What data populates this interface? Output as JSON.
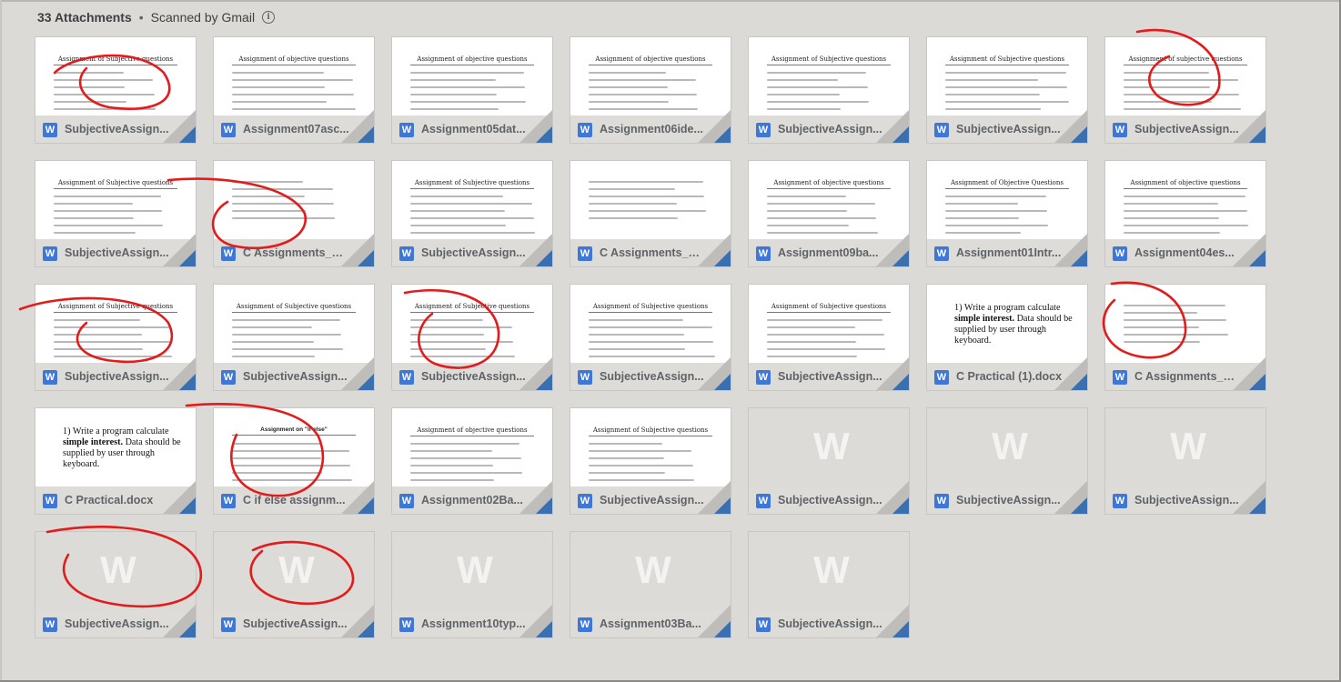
{
  "header": {
    "title": "33 Attachments",
    "separator": "•",
    "scan_status": "Scanned by Gmail",
    "info_icon": "info-icon"
  },
  "attachments": [
    {
      "name": "SubjectiveAssign...",
      "preview_title": "Assignment of Subjective questions",
      "preview": "doc"
    },
    {
      "name": "Assignment07asc...",
      "preview_title": "Assignment of objective questions",
      "preview": "doc"
    },
    {
      "name": "Assignment05dat...",
      "preview_title": "Assignment of objective questions",
      "preview": "doc"
    },
    {
      "name": "Assignment06ide...",
      "preview_title": "Assignment of objective questions",
      "preview": "doc"
    },
    {
      "name": "SubjectiveAssign...",
      "preview_title": "Assignment of Subjective questions",
      "preview": "doc"
    },
    {
      "name": "SubjectiveAssign...",
      "preview_title": "Assignment of Subjective questions",
      "preview": "doc"
    },
    {
      "name": "SubjectiveAssign...",
      "preview_title": "Assignment of subjective questions",
      "preview": "doc"
    },
    {
      "name": "SubjectiveAssign...",
      "preview_title": "Assignment of Subjective questions",
      "preview": "doc"
    },
    {
      "name": "C Assignments_W...",
      "preview_title": "",
      "preview": "doc"
    },
    {
      "name": "SubjectiveAssign...",
      "preview_title": "Assignment of Subjective questions",
      "preview": "doc"
    },
    {
      "name": "C Assignments_W...",
      "preview_title": "",
      "preview": "doc"
    },
    {
      "name": "Assignment09ba...",
      "preview_title": "Assignment of objective questions",
      "preview": "doc"
    },
    {
      "name": "Assignment01Intr...",
      "preview_title": "Assignment of Objective Questions",
      "preview": "doc"
    },
    {
      "name": "Assignment04es...",
      "preview_title": "Assignment of objective questions",
      "preview": "doc"
    },
    {
      "name": "SubjectiveAssign...",
      "preview_title": "Assignment of Subjective questions",
      "preview": "doc"
    },
    {
      "name": "SubjectiveAssign...",
      "preview_title": "Assignment of Subjective questions",
      "preview": "doc"
    },
    {
      "name": "SubjectiveAssign...",
      "preview_title": "Assignment of Subjective questions",
      "preview": "doc"
    },
    {
      "name": "SubjectiveAssign...",
      "preview_title": "Assignment of Subjective questions",
      "preview": "doc"
    },
    {
      "name": "SubjectiveAssign...",
      "preview_title": "Assignment of Subjective questions",
      "preview": "doc"
    },
    {
      "name": "C Practical (1).docx",
      "preview_title": "",
      "preview": "bigtext",
      "big_text_num": "1)",
      "big_text_a": "Write a program calculate",
      "big_text_bold": "simple interest.",
      "big_text_b": "Data should be supplied by user through keyboard."
    },
    {
      "name": "C Assignments_W...",
      "preview_title": "",
      "preview": "doc"
    },
    {
      "name": "C Practical.docx",
      "preview_title": "",
      "preview": "bigtext",
      "big_text_num": "1)",
      "big_text_a": "Write a program calculate",
      "big_text_bold": "simple interest.",
      "big_text_b": "Data should be supplied by user through keyboard."
    },
    {
      "name": "C if else assignm...",
      "preview_title": "Assignment on \"if-else\"",
      "preview": "doc-alt"
    },
    {
      "name": "Assignment02Ba...",
      "preview_title": "Assignment of objective questions",
      "preview": "doc"
    },
    {
      "name": "SubjectiveAssign...",
      "preview_title": "Assignment of Subjective questions",
      "preview": "doc"
    },
    {
      "name": "SubjectiveAssign...",
      "preview_title": "",
      "preview": "blank"
    },
    {
      "name": "SubjectiveAssign...",
      "preview_title": "",
      "preview": "blank"
    },
    {
      "name": "SubjectiveAssign...",
      "preview_title": "",
      "preview": "blank"
    },
    {
      "name": "SubjectiveAssign...",
      "preview_title": "",
      "preview": "blank"
    },
    {
      "name": "SubjectiveAssign...",
      "preview_title": "",
      "preview": "blank"
    },
    {
      "name": "Assignment10typ...",
      "preview_title": "",
      "preview": "blank"
    },
    {
      "name": "Assignment03Ba...",
      "preview_title": "",
      "preview": "blank"
    },
    {
      "name": "SubjectiveAssign...",
      "preview_title": "",
      "preview": "blank"
    }
  ],
  "file_type_icon": "word-doc-icon",
  "file_type_letter": "W",
  "colors": {
    "accent": "#3f77d6",
    "annotation": "#e31b1b",
    "corner": "#3a6fb0"
  }
}
